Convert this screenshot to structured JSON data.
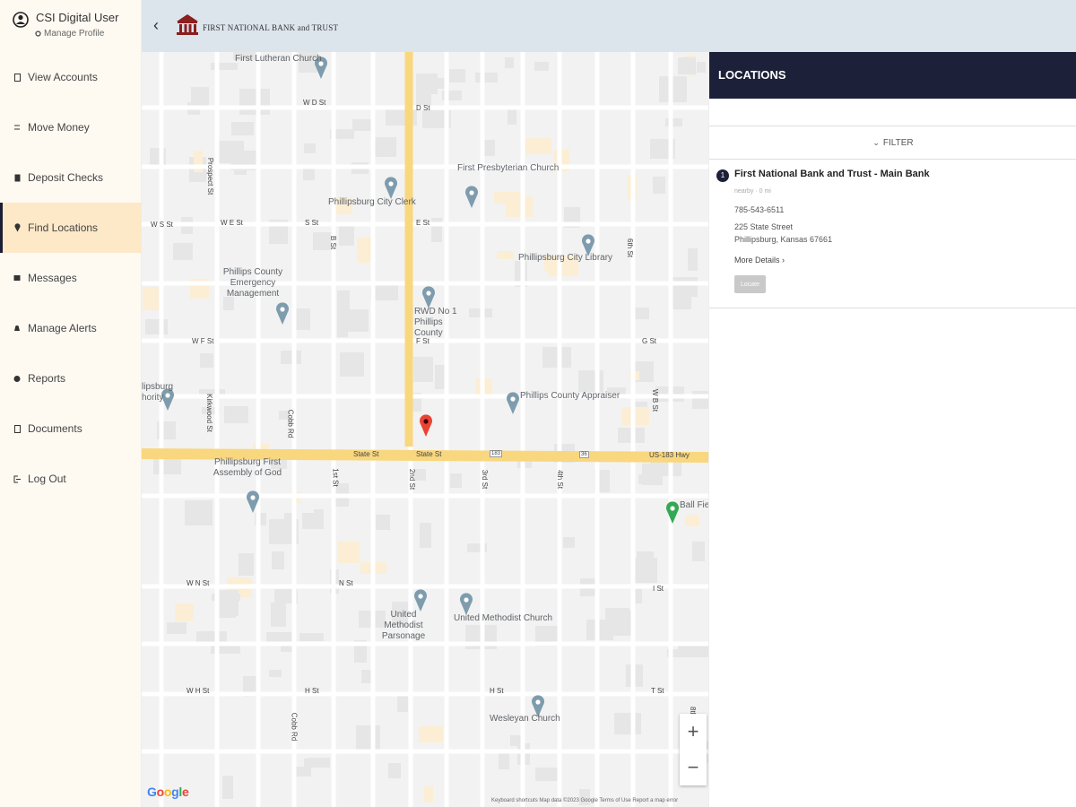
{
  "user": {
    "name": "CSI Digital User",
    "manage_profile": "Manage Profile"
  },
  "nav": [
    {
      "label": "View Accounts",
      "icon": "accounts-icon"
    },
    {
      "label": "Move Money",
      "icon": "transfer-icon"
    },
    {
      "label": "Deposit Checks",
      "icon": "check-icon"
    },
    {
      "label": "Find Locations",
      "icon": "location-pin-icon"
    },
    {
      "label": "Messages",
      "icon": "envelope-icon"
    },
    {
      "label": "Manage Alerts",
      "icon": "bell-icon"
    },
    {
      "label": "Reports",
      "icon": "report-icon"
    },
    {
      "label": "Documents",
      "icon": "document-icon"
    },
    {
      "label": "Log Out",
      "icon": "logout-icon"
    }
  ],
  "active_nav": "Find Locations",
  "header": {
    "back_glyph": "‹",
    "brand": "FIRST NATIONAL BANK and TRUST"
  },
  "map": {
    "places": [
      "First Lutheran Church",
      "First Presbyterian Church",
      "Phillipsburg City Clerk",
      "Phillipsburg City Library",
      "Phillips County Emergency Management",
      "RWD No 1 Phillips County",
      "Phillips County Appraiser",
      "Phillipsburg First Assembly of God",
      "United Methodist Parsonage",
      "United Methodist Church",
      "Wesleyan Church",
      "Ball Field",
      "lipsburg hority"
    ],
    "streets": {
      "state_st_1": "State St",
      "state_st_2": "State St",
      "us183": "US-183 Hwy",
      "shield_183a": "183",
      "shield_183b": "36",
      "e_st": "E St",
      "e_st_left": "W E St",
      "d_st": "D St",
      "w_d_st": "W D St",
      "f_st": "F St",
      "w_f_st": "W F St",
      "n_st": "N St",
      "w_n_st": "W N St",
      "nd_st": "2nd St",
      "third_st": "3rd St",
      "fourth_st": "4th St",
      "first_st": "1st St",
      "cobb": "Cobb Rd",
      "cobb2": "Cobb Rd",
      "prospect": "Prospect St",
      "kirkwood": "Kirkwood St",
      "s_st": "S St",
      "w_s_st": "W S St",
      "w_h_st": "W H St",
      "h_st": "H St",
      "eighth": "8th St",
      "sixth": "6th St",
      "e_h_st": "H St",
      "g_st": "G St",
      "i_st": "I St",
      "t_st": "T St",
      "b_st": "B St",
      "w_b_st": "W B St"
    },
    "zoom_in": "+",
    "zoom_out": "−",
    "google": "Google",
    "attribution": "Keyboard shortcuts   Map data ©2023 Google   Terms of Use   Report a map error",
    "colors": {
      "road_major": "#f9d77e",
      "road_minor": "#ffffff",
      "block": "#e8e8e8",
      "pin_poi": "#7e9cad",
      "pin_selected": "#ea4335",
      "pin_park": "#34a853"
    }
  },
  "panel": {
    "title": "LOCATIONS",
    "filter": "FILTER",
    "filter_chevron": "⌄",
    "location": {
      "number": "1",
      "name": "First National Bank and Trust - Main Bank",
      "distance": "nearby · 0 mi",
      "phone": "785-543-6511",
      "address_line1": "225 State Street",
      "address_line2": "Phillipsburg, Kansas 67661",
      "more_details": "More Details ›",
      "locate": "Locate"
    }
  }
}
